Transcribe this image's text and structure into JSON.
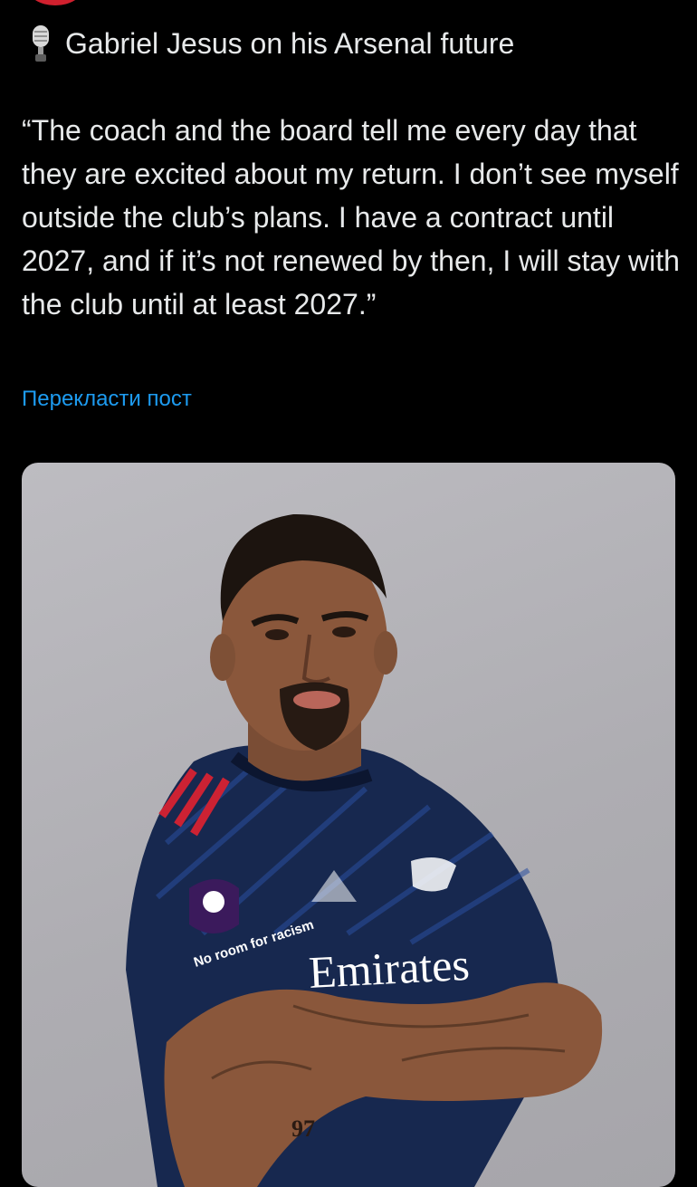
{
  "post": {
    "title_icon": "microphone-icon",
    "title": "Gabriel Jesus on his Arsenal future",
    "body": "“The coach and the board tell me every day that they are excited about my return. I don’t see myself outside the club’s plans. I have a contract until 2027, and if it’s not renewed by then, I will stay with the club until at least 2027.”",
    "translate_link": "Перекласти пост",
    "photo": {
      "sponsor_text": "Emirates",
      "sleeve_badge_text": "No room for racism",
      "tattoo_number": "97"
    }
  },
  "colors": {
    "background": "#000000",
    "text": "#e7e9ea",
    "link": "#1d9bf0",
    "avatar_accent": "#d0202e",
    "photo_backdrop": "#b5b4b9",
    "jersey_navy": "#17284f",
    "jersey_stripe": "#cc2233"
  }
}
